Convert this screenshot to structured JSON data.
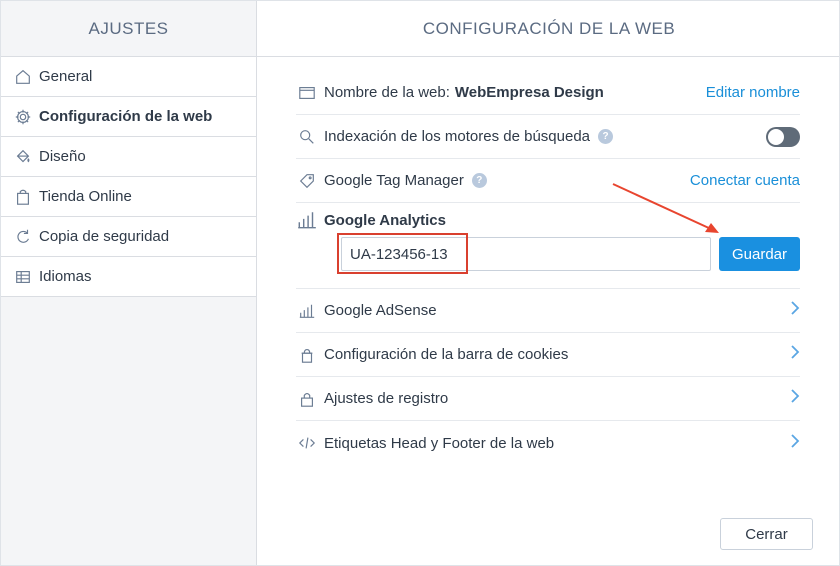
{
  "sidebar": {
    "title": "AJUSTES",
    "items": [
      {
        "label": "General",
        "icon": "home-icon"
      },
      {
        "label": "Configuración de la web",
        "icon": "gear-icon",
        "active": true
      },
      {
        "label": "Diseño",
        "icon": "paint-bucket-icon"
      },
      {
        "label": "Tienda Online",
        "icon": "shopping-bag-icon"
      },
      {
        "label": "Copia de seguridad",
        "icon": "backup-icon"
      },
      {
        "label": "Idiomas",
        "icon": "flag-icon"
      }
    ]
  },
  "main": {
    "title": "CONFIGURACIÓN DE LA WEB",
    "site_name_label": "Nombre de la web:",
    "site_name_value": "WebEmpresa Design",
    "edit_name_link": "Editar nombre",
    "indexing_label": "Indexación de los motores de búsqueda",
    "indexing_enabled": false,
    "gtm_label": "Google Tag Manager",
    "gtm_link": "Conectar cuenta",
    "help_glyph": "?",
    "ga_title": "Google Analytics",
    "ga_value": "UA-123456-13",
    "save_label": "Guardar",
    "adsense_label": "Google AdSense",
    "cookies_label": "Configuración de la barra de cookies",
    "registration_label": "Ajustes de registro",
    "head_footer_label": "Etiquetas Head y Footer de la web",
    "close_label": "Cerrar"
  },
  "colors": {
    "accent": "#1a90e0",
    "annotation": "#d9402f"
  }
}
